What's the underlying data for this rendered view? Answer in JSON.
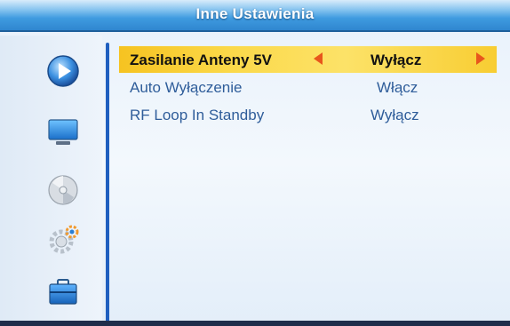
{
  "header": {
    "title": "Inne Ustawienia"
  },
  "sidebar": {
    "icons": [
      {
        "name": "play-icon",
        "active": true
      },
      {
        "name": "monitor-icon",
        "active": false
      },
      {
        "name": "disc-icon",
        "active": false
      },
      {
        "name": "settings-gear-icon",
        "active": false
      },
      {
        "name": "toolbox-icon",
        "active": false
      }
    ]
  },
  "settings": [
    {
      "label": "Zasilanie Anteny 5V",
      "value": "Wyłącz",
      "selected": true
    },
    {
      "label": "Auto Wyłączenie",
      "value": "Włącz",
      "selected": false
    },
    {
      "label": "RF Loop In Standby",
      "value": "Wyłącz",
      "selected": false
    }
  ],
  "colors": {
    "title_bar": "#3f9be0",
    "highlight": "#fbd94a",
    "arrow": "#e8561c",
    "label_text": "#2f5d9a",
    "divider": "#1f5fbf"
  }
}
